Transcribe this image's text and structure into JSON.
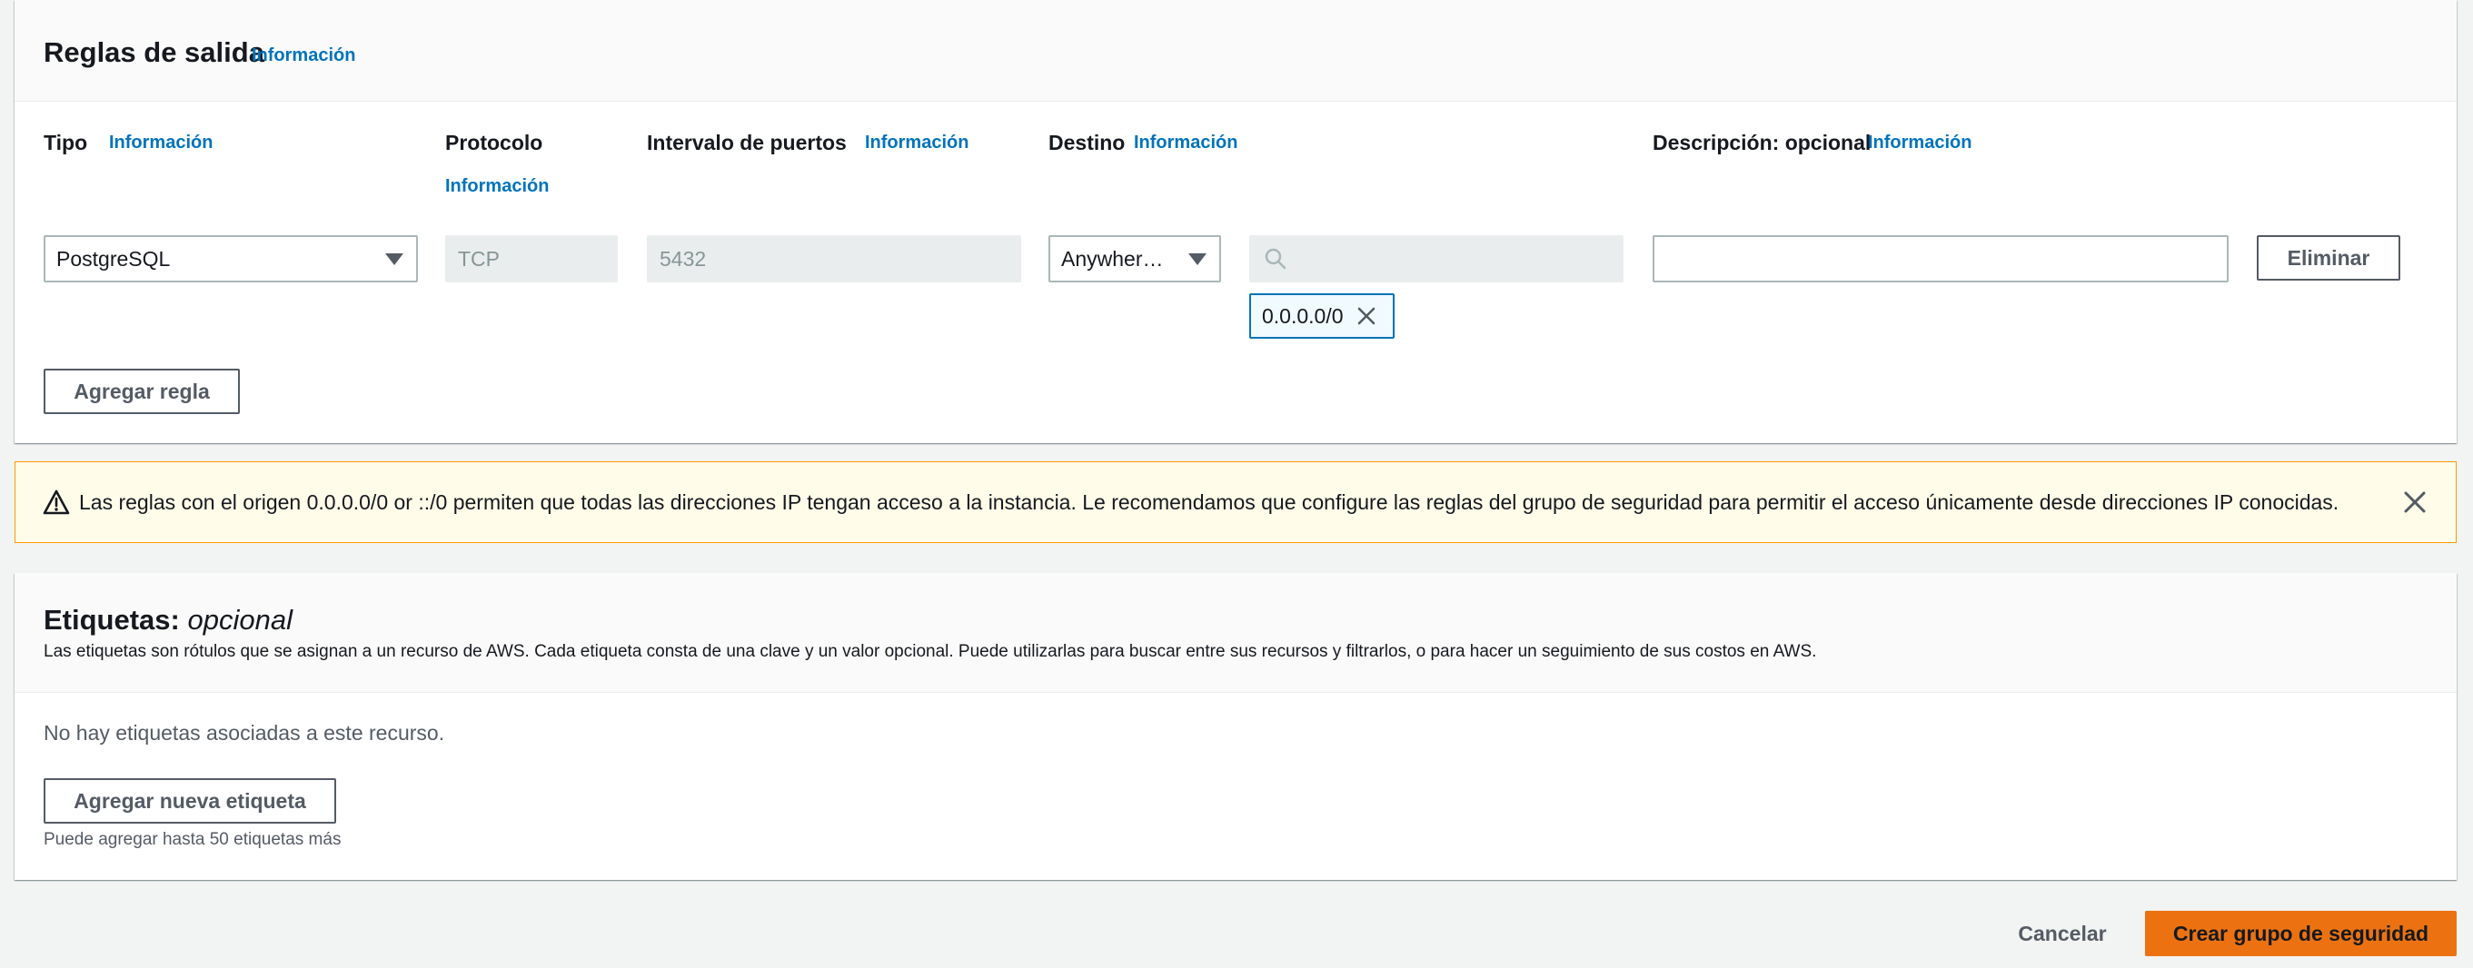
{
  "outbound_rules": {
    "title": "Reglas de salida",
    "info": "Información",
    "columns": {
      "type": "Tipo",
      "type_info": "Información",
      "protocol": "Protocolo",
      "protocol_info": "Información",
      "port_range": "Intervalo de puertos",
      "port_range_info": "Información",
      "destination": "Destino",
      "destination_info": "Información",
      "description": "Descripción: opcional",
      "description_info": "Información"
    },
    "rule": {
      "type_value": "PostgreSQL",
      "protocol_value": "TCP",
      "port_value": "5432",
      "destination_type": "Anywher…",
      "destination_search_value": "",
      "destination_token": "0.0.0.0/0",
      "description_value": "",
      "delete_label": "Eliminar"
    },
    "add_rule_label": "Agregar regla"
  },
  "warning": {
    "text": "Las reglas con el origen 0.0.0.0/0 or ::/0 permiten que todas las direcciones IP tengan acceso a la instancia. Le recomendamos que configure las reglas del grupo de seguridad para permitir el acceso únicamente desde direcciones IP conocidas."
  },
  "tags": {
    "title": "Etiquetas:",
    "title_optional": "opcional",
    "description": "Las etiquetas son rótulos que se asignan a un recurso de AWS. Cada etiqueta consta de una clave y un valor opcional. Puede utilizarlas para buscar entre sus recursos y filtrarlos, o para hacer un seguimiento de sus costos en AWS.",
    "empty": "No hay etiquetas asociadas a este recurso.",
    "add_label": "Agregar nueva etiqueta",
    "hint": "Puede agregar hasta 50 etiquetas más"
  },
  "footer": {
    "cancel": "Cancelar",
    "create": "Crear grupo de seguridad"
  },
  "colors": {
    "link": "#0073bb",
    "primary": "#ec7211",
    "warning_bg": "#fffce9",
    "warning_border": "#ff9900"
  }
}
